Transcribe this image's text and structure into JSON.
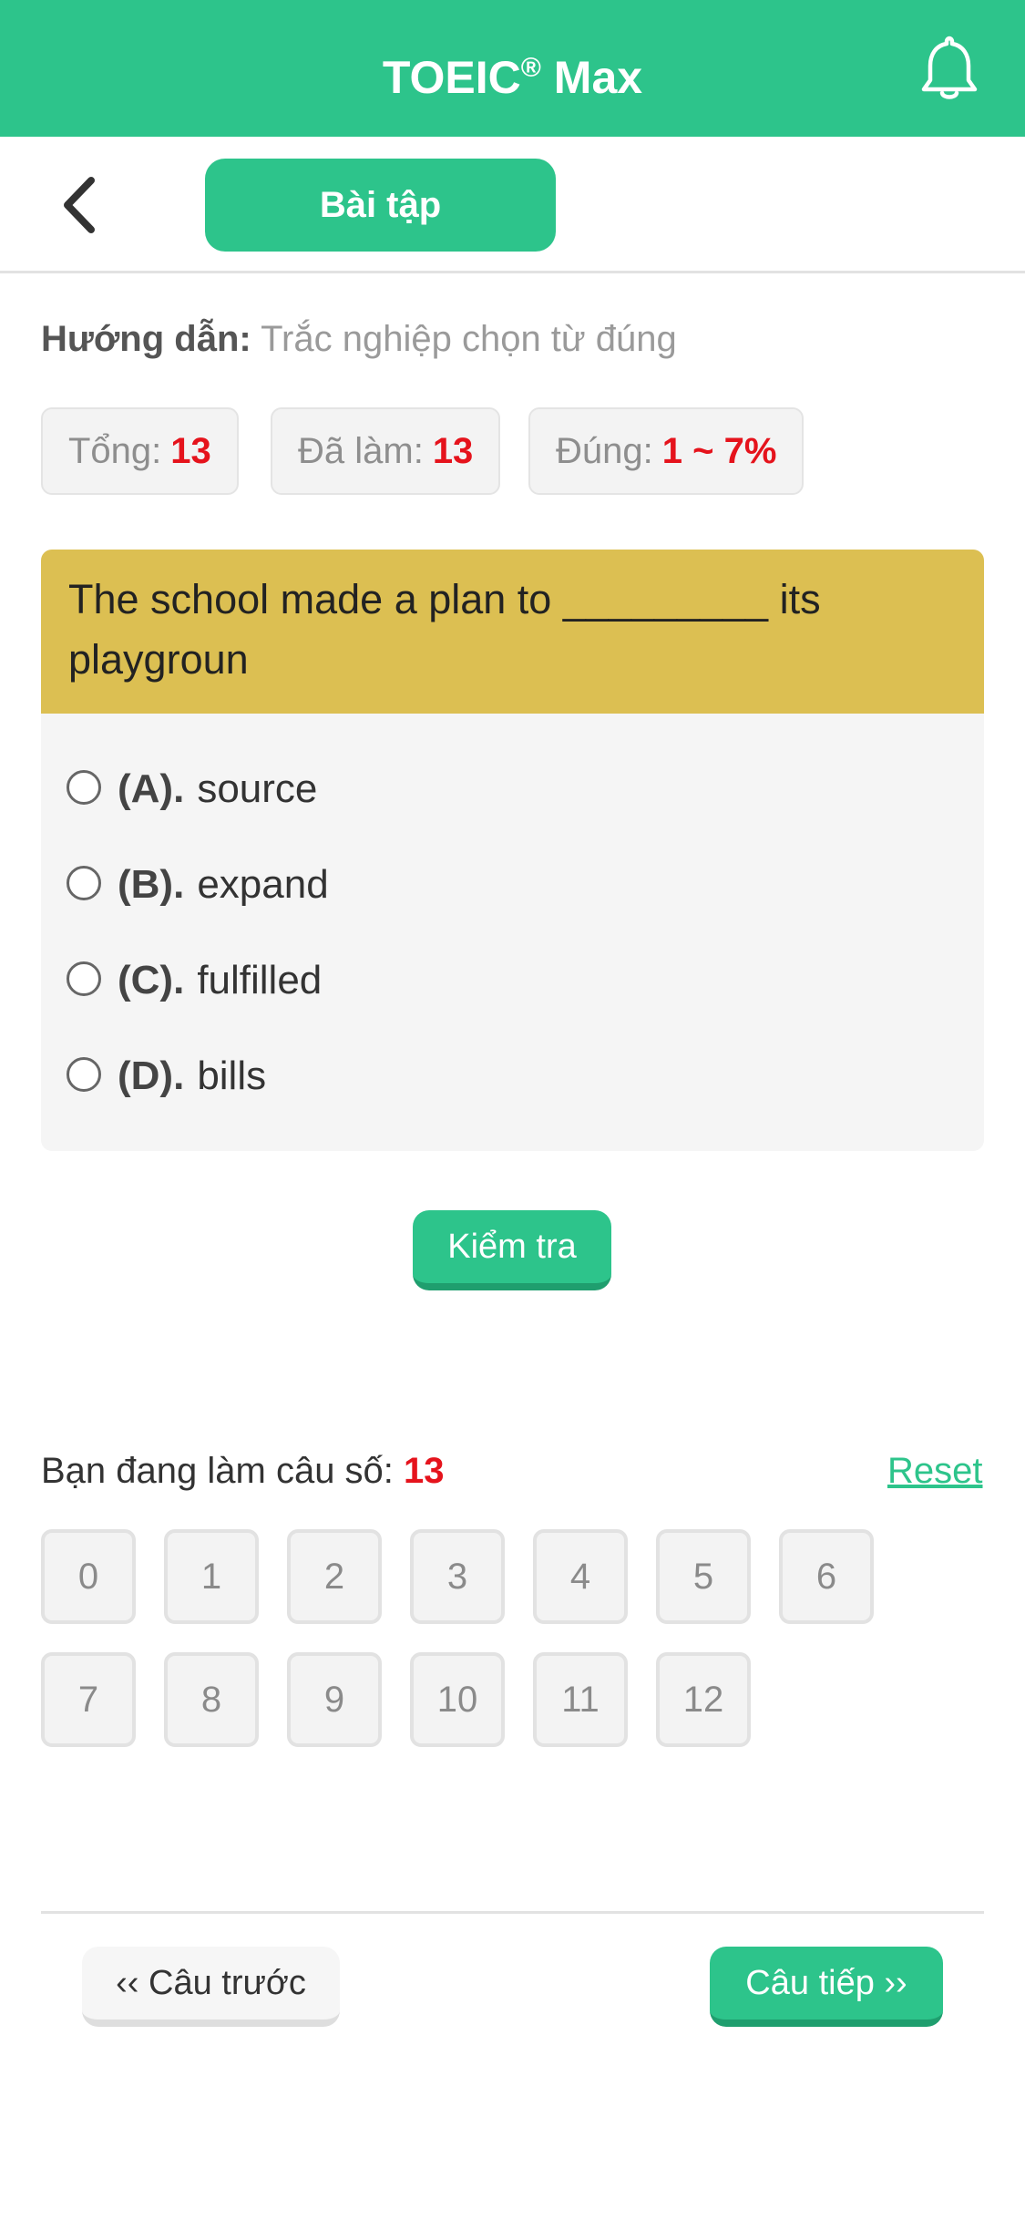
{
  "header": {
    "app_title": "TOEIC",
    "app_title_mark": "®",
    "app_title_suffix": " Max",
    "bell_icon": "bell-icon",
    "back_icon": "chevron-left-icon",
    "tab_label": "Bài tập"
  },
  "instruction": {
    "label": "Hướng dẫn:",
    "text": " Trắc nghiệp chọn từ đúng"
  },
  "stats": {
    "total_label": "Tổng:",
    "total_value": "13",
    "done_label": "Đã làm:",
    "done_value": "13",
    "correct_label": "Đúng:",
    "correct_value": "1 ~ 7%"
  },
  "question": {
    "text": "The school made a plan to _________ its playgroun",
    "options": [
      {
        "key": "(A).",
        "text": "source"
      },
      {
        "key": "(B).",
        "text": "expand"
      },
      {
        "key": "(C).",
        "text": "fulfilled"
      },
      {
        "key": "(D).",
        "text": "bills"
      }
    ],
    "check_label": "Kiểm tra"
  },
  "progress": {
    "label": "Bạn đang làm câu số:",
    "current": "13",
    "reset_label": "Reset",
    "numbers": [
      "0",
      "1",
      "2",
      "3",
      "4",
      "5",
      "6",
      "7",
      "8",
      "9",
      "10",
      "11",
      "12"
    ]
  },
  "nav": {
    "prev_label": "‹‹ Câu trước",
    "next_label": "Câu tiếp ››"
  },
  "colors": {
    "brand": "#2dc48b",
    "question_header": "#dcbf52",
    "highlight": "#e5131c"
  }
}
